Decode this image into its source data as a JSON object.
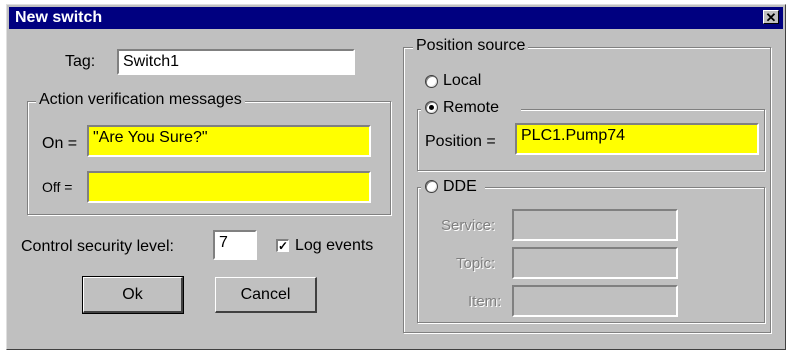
{
  "window": {
    "title": "New switch",
    "close_glyph": "✕"
  },
  "tag": {
    "label": "Tag:",
    "value": "Switch1"
  },
  "messages": {
    "group_label": "Action verification messages",
    "on_label": "On =",
    "on_value": "\"Are You Sure?\"",
    "off_label": "Off =",
    "off_value": ""
  },
  "security": {
    "label": "Control security level:",
    "value": "7"
  },
  "log_events": {
    "label": "Log events",
    "checked": true,
    "mark": "✓"
  },
  "buttons": {
    "ok": "Ok",
    "cancel": "Cancel"
  },
  "position_source": {
    "group_label": "Position source",
    "local_label": "Local",
    "remote_label": "Remote",
    "selected": "Remote",
    "position_label": "Position =",
    "position_value": "PLC1.Pump74",
    "dde_label": "DDE",
    "service_label": "Service:",
    "topic_label": "Topic:",
    "item_label": "Item:",
    "service_value": "",
    "topic_value": "",
    "item_value": ""
  },
  "colors": {
    "title_bar": "#000080",
    "dialog_face": "#c0c0c0",
    "highlight_field": "#ffff00"
  }
}
